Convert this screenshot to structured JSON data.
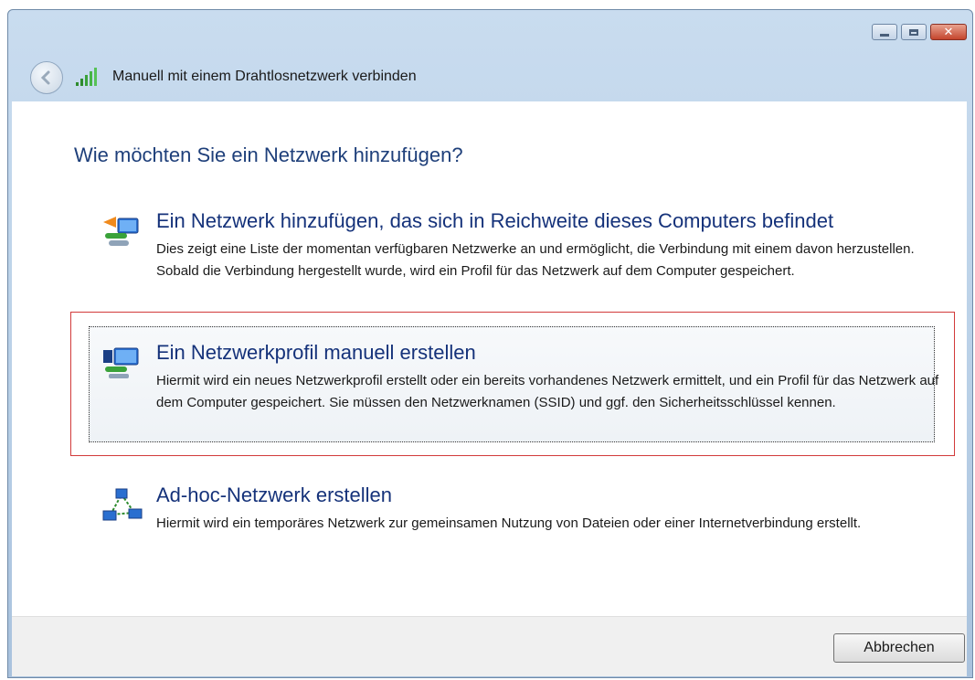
{
  "window": {
    "title": "Manuell mit einem Drahtlosnetzwerk verbinden",
    "caption": {
      "minimize": "minimize-icon",
      "maximize": "maximize-icon",
      "close": "close-icon"
    }
  },
  "main": {
    "heading": "Wie möchten Sie ein Netzwerk hinzufügen?",
    "options": [
      {
        "title": "Ein Netzwerk hinzufügen, das sich in Reichweite dieses Computers befindet",
        "description": "Dies zeigt eine Liste der momentan verfügbaren Netzwerke an und ermöglicht, die Verbindung mit einem davon herzustellen. Sobald die Verbindung hergestellt wurde, wird ein Profil für das Netzwerk auf dem Computer gespeichert.",
        "icon": "network-search-icon"
      },
      {
        "title": "Ein Netzwerkprofil manuell erstellen",
        "description": "Hiermit wird ein neues Netzwerkprofil erstellt oder ein bereits vorhandenes Netzwerk ermittelt, und ein Profil für das Netzwerk auf dem Computer gespeichert. Sie müssen den Netzwerknamen (SSID) und ggf. den Sicherheitsschlüssel kennen.",
        "icon": "network-profile-icon",
        "focused": true
      },
      {
        "title": "Ad-hoc-Netzwerk erstellen",
        "description": "Hiermit wird ein temporäres Netzwerk zur gemeinsamen Nutzung von Dateien oder einer Internetverbindung erstellt.",
        "icon": "adhoc-network-icon"
      }
    ]
  },
  "footer": {
    "cancel_label": "Abbrechen"
  },
  "colors": {
    "accent": "#15327a",
    "focus_border": "#d23a3a"
  }
}
